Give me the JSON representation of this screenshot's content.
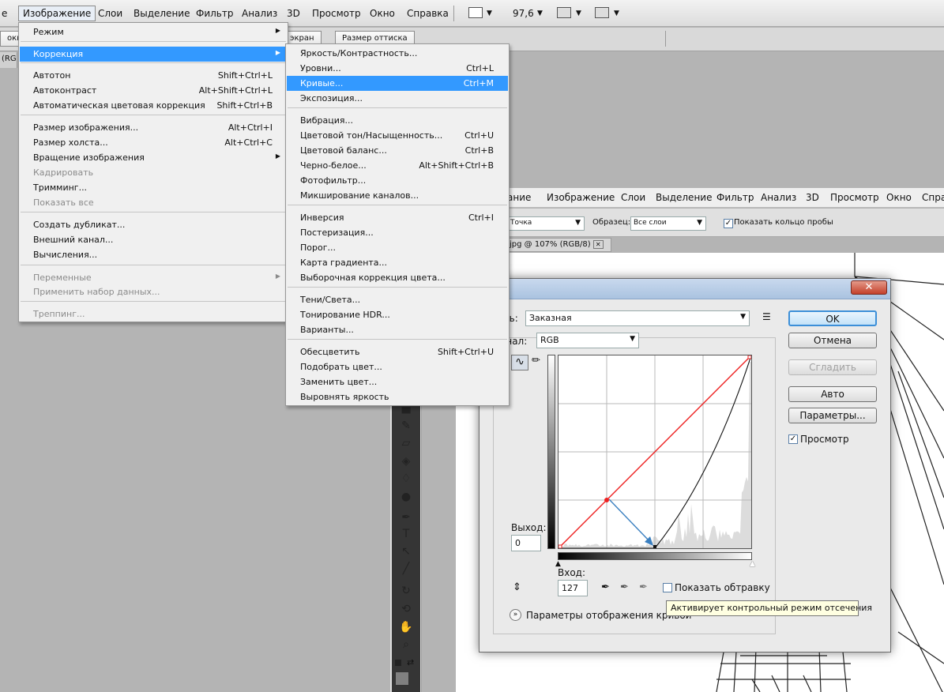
{
  "menubar": {
    "items": [
      {
        "label": "е"
      },
      {
        "label": "Изображение"
      },
      {
        "label": "Слои"
      },
      {
        "label": "Выделение"
      },
      {
        "label": "Фильтр"
      },
      {
        "label": "Анализ"
      },
      {
        "label": "3D"
      },
      {
        "label": "Просмотр"
      },
      {
        "label": "Окно"
      },
      {
        "label": "Справка"
      }
    ],
    "zoom": "97,6"
  },
  "optbar": {
    "buttons": [
      "окна",
      "экран",
      "Размер оттиска"
    ]
  },
  "tabstrip": {
    "label": "(RG"
  },
  "image_menu": {
    "items": [
      {
        "label": "Режим",
        "shortcut": "",
        "sub": true
      },
      {
        "label": "Коррекция",
        "shortcut": "",
        "sub": true,
        "highlight": true
      },
      {
        "label": "Автотон",
        "shortcut": "Shift+Ctrl+L"
      },
      {
        "label": "Автоконтраст",
        "shortcut": "Alt+Shift+Ctrl+L"
      },
      {
        "label": "Автоматическая цветовая коррекция",
        "shortcut": "Shift+Ctrl+B"
      },
      {
        "label": "Размер изображения...",
        "shortcut": "Alt+Ctrl+I"
      },
      {
        "label": "Размер холста...",
        "shortcut": "Alt+Ctrl+C"
      },
      {
        "label": "Вращение изображения",
        "shortcut": "",
        "sub": true
      },
      {
        "label": "Кадрировать",
        "shortcut": "",
        "disabled": true
      },
      {
        "label": "Тримминг...",
        "shortcut": ""
      },
      {
        "label": "Показать все",
        "shortcut": "",
        "disabled": true
      },
      {
        "label": "Создать дубликат...",
        "shortcut": ""
      },
      {
        "label": "Внешний канал...",
        "shortcut": ""
      },
      {
        "label": "Вычисления...",
        "shortcut": ""
      },
      {
        "label": "Переменные",
        "shortcut": "",
        "sub": true,
        "disabled": true
      },
      {
        "label": "Применить набор данных...",
        "shortcut": "",
        "disabled": true
      },
      {
        "label": "Треппинг...",
        "shortcut": "",
        "disabled": true
      }
    ]
  },
  "corr_menu": {
    "items": [
      {
        "label": "Яркость/Контрастность...",
        "shortcut": ""
      },
      {
        "label": "Уровни...",
        "shortcut": "Ctrl+L"
      },
      {
        "label": "Кривые...",
        "shortcut": "Ctrl+M",
        "highlight": true
      },
      {
        "label": "Экспозиция...",
        "shortcut": ""
      },
      {
        "label": "Вибрация...",
        "shortcut": ""
      },
      {
        "label": "Цветовой тон/Насыщенность...",
        "shortcut": "Ctrl+U"
      },
      {
        "label": "Цветовой баланс...",
        "shortcut": "Ctrl+B"
      },
      {
        "label": "Черно-белое...",
        "shortcut": "Alt+Shift+Ctrl+B"
      },
      {
        "label": "Фотофильтр...",
        "shortcut": ""
      },
      {
        "label": "Микширование каналов...",
        "shortcut": ""
      },
      {
        "label": "Инверсия",
        "shortcut": "Ctrl+I"
      },
      {
        "label": "Постеризация...",
        "shortcut": ""
      },
      {
        "label": "Порог...",
        "shortcut": ""
      },
      {
        "label": "Карта градиента...",
        "shortcut": ""
      },
      {
        "label": "Выборочная коррекция цвета...",
        "shortcut": ""
      },
      {
        "label": "Тени/Света...",
        "shortcut": ""
      },
      {
        "label": "Тонирование HDR...",
        "shortcut": ""
      },
      {
        "label": "Варианты...",
        "shortcut": ""
      },
      {
        "label": "Обесцветить",
        "shortcut": "Shift+Ctrl+U"
      },
      {
        "label": "Подобрать цвет...",
        "shortcut": ""
      },
      {
        "label": "Заменить цвет...",
        "shortcut": ""
      },
      {
        "label": "Выровнять яркость",
        "shortcut": ""
      }
    ]
  },
  "bgwindow": {
    "menu": [
      "ание",
      "Изображение",
      "Слои",
      "Выделение",
      "Фильтр",
      "Анализ",
      "3D",
      "Просмотр",
      "Окно",
      "Спра"
    ],
    "sample_combo": "Точка",
    "sample_label": "Образец:",
    "layers_combo": "Все слои",
    "ring_label": "Показать кольцо пробы",
    "doc_tab": "jpg @ 107% (RGB/8)"
  },
  "dialog": {
    "title": "е",
    "preset_label": "ль:",
    "preset_value": "Заказная",
    "channel_label": "анал:",
    "channel_value": "RGB",
    "buttons": {
      "ok": "OK",
      "cancel": "Отмена",
      "smooth": "Сгладить",
      "auto": "Авто",
      "options": "Параметры..."
    },
    "preview_label": "Просмотр",
    "output_label": "Выход:",
    "output_value": "0",
    "input_label": "Вход:",
    "input_value": "127",
    "clip_label": "Показать обтравку",
    "display_options": "Параметры отображения кривой"
  },
  "tooltip": "Активирует контрольный режим отсечения",
  "colors": {
    "highlight": "#3399ff",
    "curve_red": "#ee2222",
    "arrow_blue": "#3a7fc0",
    "ok_border": "#3c8fd8"
  }
}
